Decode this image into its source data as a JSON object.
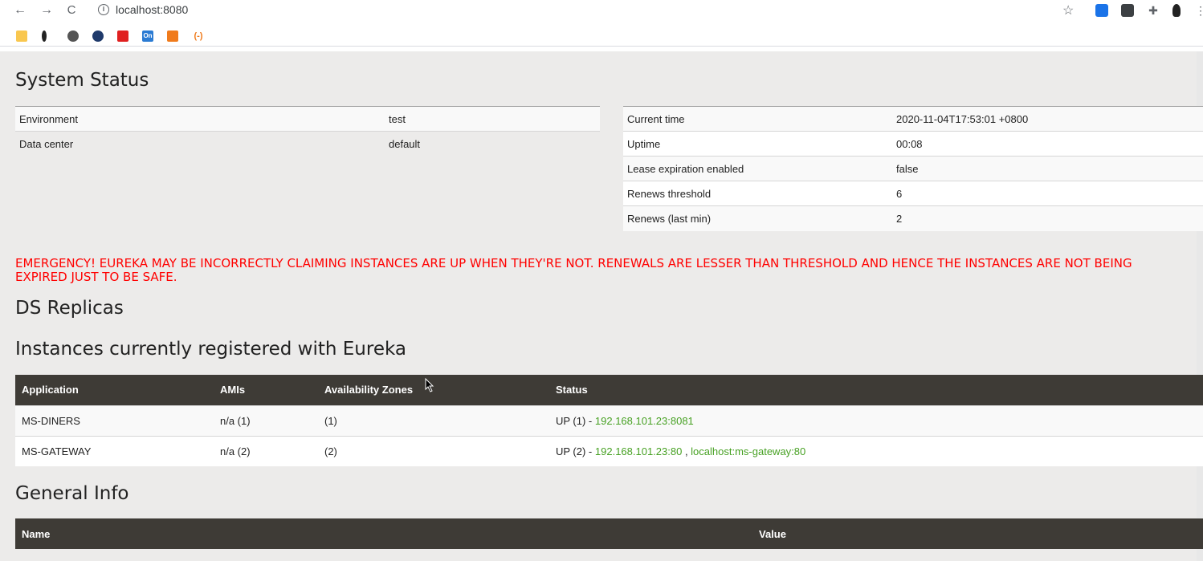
{
  "browser": {
    "url": "localhost:8080",
    "nav": {
      "back": "←",
      "forward": "→",
      "reload": "C"
    }
  },
  "page": {
    "system_status_title": "System Status",
    "left_table": [
      {
        "key": "Environment",
        "value": "test"
      },
      {
        "key": "Data center",
        "value": "default"
      }
    ],
    "right_table": [
      {
        "key": "Current time",
        "value": "2020-11-04T17:53:01 +0800"
      },
      {
        "key": "Uptime",
        "value": "00:08"
      },
      {
        "key": "Lease expiration enabled",
        "value": "false"
      },
      {
        "key": "Renews threshold",
        "value": "6"
      },
      {
        "key": "Renews (last min)",
        "value": "2"
      }
    ],
    "emergency": "EMERGENCY! EUREKA MAY BE INCORRECTLY CLAIMING INSTANCES ARE UP WHEN THEY'RE NOT. RENEWALS ARE LESSER THAN THRESHOLD AND HENCE THE INSTANCES ARE NOT BEING EXPIRED JUST TO BE SAFE.",
    "ds_replicas_title": "DS Replicas",
    "instances_title": "Instances currently registered with Eureka",
    "instances_headers": [
      "Application",
      "AMIs",
      "Availability Zones",
      "Status"
    ],
    "instances": [
      {
        "application": "MS-DINERS",
        "amis": "n/a (1)",
        "zones": "(1)",
        "status_prefix": "UP (1) - ",
        "links": [
          "192.168.101.23:8081"
        ],
        "sep": ""
      },
      {
        "application": "MS-GATEWAY",
        "amis": "n/a (2)",
        "zones": "(2)",
        "status_prefix": "UP (2) - ",
        "links": [
          "192.168.101.23:80",
          "localhost:ms-gateway:80"
        ],
        "sep": " , "
      }
    ],
    "general_info_title": "General Info",
    "general_headers": [
      "Name",
      "Value"
    ]
  },
  "colors": {
    "header_bg": "#3e3b36",
    "emergency": "#ff0000",
    "link": "#47a123",
    "page_bg": "#ecebea"
  }
}
